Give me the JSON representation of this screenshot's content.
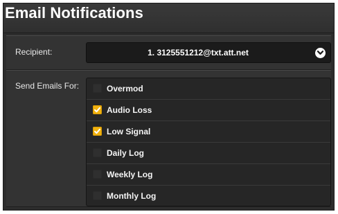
{
  "title": "Email Notifications",
  "recipient": {
    "label": "Recipient:",
    "selected": "1. 3125551212@txt.att.net"
  },
  "send_emails_for": {
    "label": "Send Emails For:",
    "options": [
      {
        "label": "Overmod",
        "checked": false
      },
      {
        "label": "Audio Loss",
        "checked": true
      },
      {
        "label": "Low Signal",
        "checked": true
      },
      {
        "label": "Daily Log",
        "checked": false
      },
      {
        "label": "Weekly Log",
        "checked": false
      },
      {
        "label": "Monthly Log",
        "checked": false
      }
    ]
  },
  "colors": {
    "panel": "#2d2d2d",
    "checkbox_checked": "#f1b20f",
    "text": "#ffffff"
  },
  "icons": {
    "dropdown": "chevron-down-icon",
    "check": "checkmark-icon"
  }
}
